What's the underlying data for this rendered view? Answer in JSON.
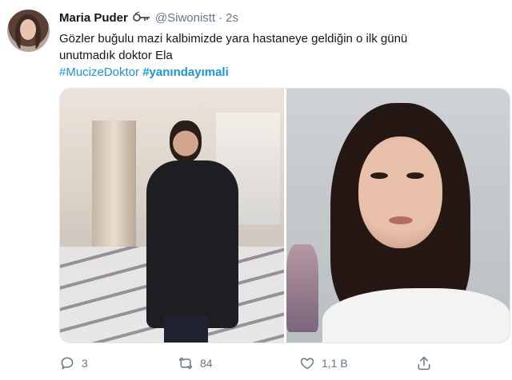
{
  "tweet": {
    "author_name": "Maria Puder",
    "badge_icon": "key-icon",
    "handle": "@Siwonistt",
    "separator": "·",
    "time": "2s",
    "text_line1": "Gözler buğulu mazi kalbimizde yara hastaneye geldiğin o ilk günü",
    "text_line2": "unutmadık doktor Ela",
    "hashtag1": "#MucizeDoktor",
    "hashtag2": "#yanındayımali"
  },
  "actions": {
    "reply": {
      "icon": "reply-icon",
      "count": "3"
    },
    "retweet": {
      "icon": "retweet-icon",
      "count": "84"
    },
    "like": {
      "icon": "heart-icon",
      "count": "1,1 B"
    },
    "share": {
      "icon": "share-icon"
    }
  },
  "colors": {
    "link": "#1b95e0",
    "muted": "#657786",
    "text": "#14171a"
  }
}
